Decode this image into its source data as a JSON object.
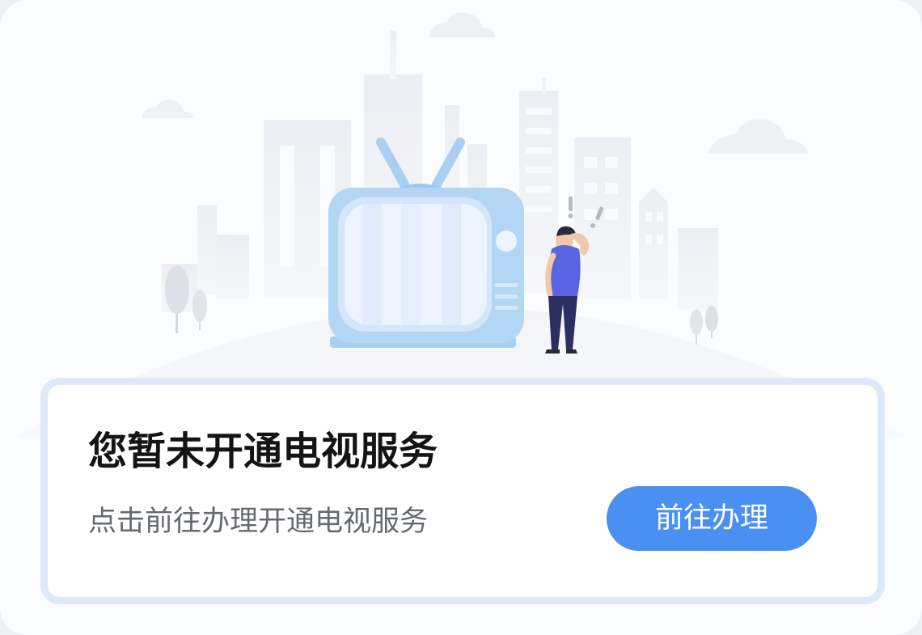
{
  "empty_state": {
    "title": "您暂未开通电视服务",
    "subtitle": "点击前往办理开通电视服务",
    "button_label": "前往办理"
  },
  "illustration": {
    "subject": "tv-with-confused-person-icon",
    "colors": {
      "tv_body": "#a9d0f3",
      "tv_screen": "#e9f1fc",
      "person_shirt": "#5a63e0",
      "person_pants": "#2c2f63",
      "buildings": "#eef0f4"
    }
  },
  "theme": {
    "accent": "#4a8ff2",
    "card_border": "#dde9fb",
    "background": "#fbfcfe"
  }
}
